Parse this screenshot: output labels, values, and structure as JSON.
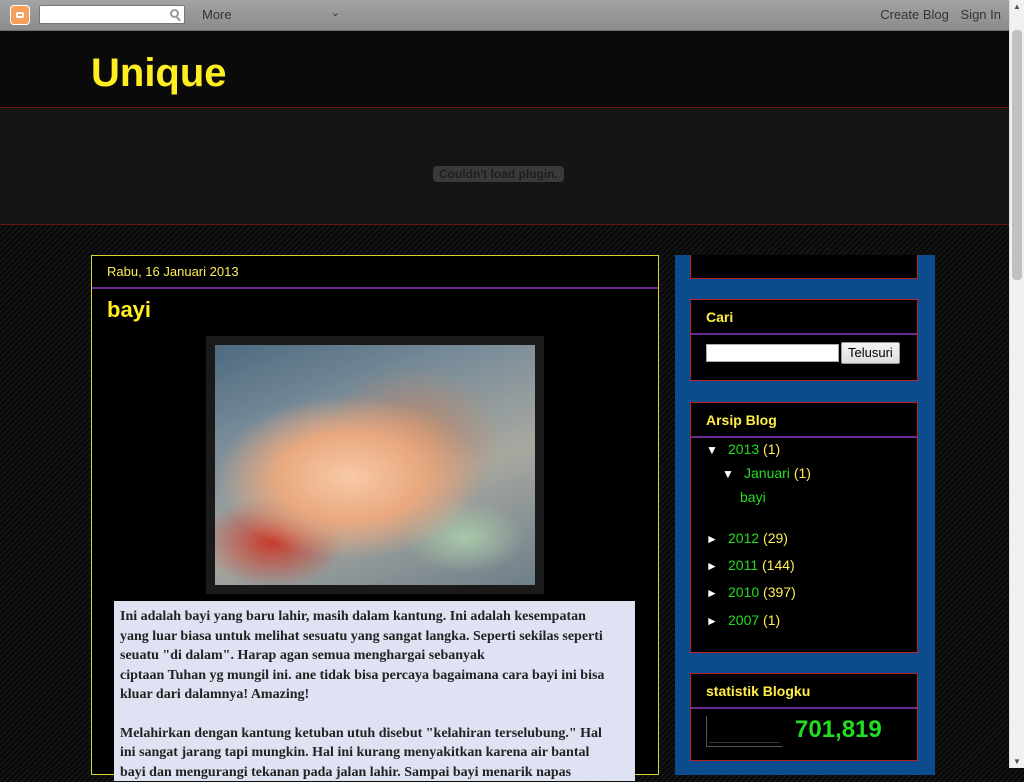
{
  "navbar": {
    "more_label": "More",
    "create_blog": "Create Blog",
    "sign_in": "Sign In"
  },
  "header": {
    "title": "Unique",
    "plugin_message": "Couldn't load plugin."
  },
  "post": {
    "date": "Rabu, 16 Januari 2013",
    "title": "bayi",
    "paragraph1": "Ini adalah bayi yang baru lahir, masih dalam kantung. Ini adalah kesempatan\nyang luar biasa untuk melihat sesuatu yang sangat langka. Seperti sekilas seperti\nseuatu \"di dalam\". Harap agan semua menghargai sebanyak\nciptaan Tuhan yg mungil ini. ane tidak bisa percaya bagaimana cara bayi ini bisa\nkluar dari dalamnya! Amazing!",
    "paragraph2": "Melahirkan dengan kantung ketuban utuh disebut \"kelahiran terselubung.\" Hal\nini sangat jarang tapi mungkin. Hal ini kurang menyakitkan karena air bantal\nbayi dan mengurangi tekanan pada jalan lahir. Sampai bayi menarik napas"
  },
  "sidebar": {
    "search": {
      "title": "Cari",
      "button": "Telusuri"
    },
    "archive": {
      "title": "Arsip Blog",
      "y2013": {
        "toggle": "▼",
        "year": "2013",
        "count": "(1)"
      },
      "jan": {
        "toggle": "▼",
        "label": "Januari",
        "count": "(1)"
      },
      "post_link": "bayi",
      "y2012": {
        "toggle": "►",
        "year": "2012",
        "count": "(29)"
      },
      "y2011": {
        "toggle": "►",
        "year": "2011",
        "count": "(144)"
      },
      "y2010": {
        "toggle": "►",
        "year": "2010",
        "count": "(397)"
      },
      "y2007": {
        "toggle": "►",
        "year": "2007",
        "count": "(1)"
      }
    },
    "stats": {
      "title": "statistik Blogku",
      "count": "701,819"
    }
  },
  "colors": {
    "title_yellow": "#ffee22",
    "link_green": "#22dd22",
    "sidebar_blue": "#0c4c8c",
    "widget_border": "#b82222",
    "divider_purple": "#6a2a98"
  }
}
